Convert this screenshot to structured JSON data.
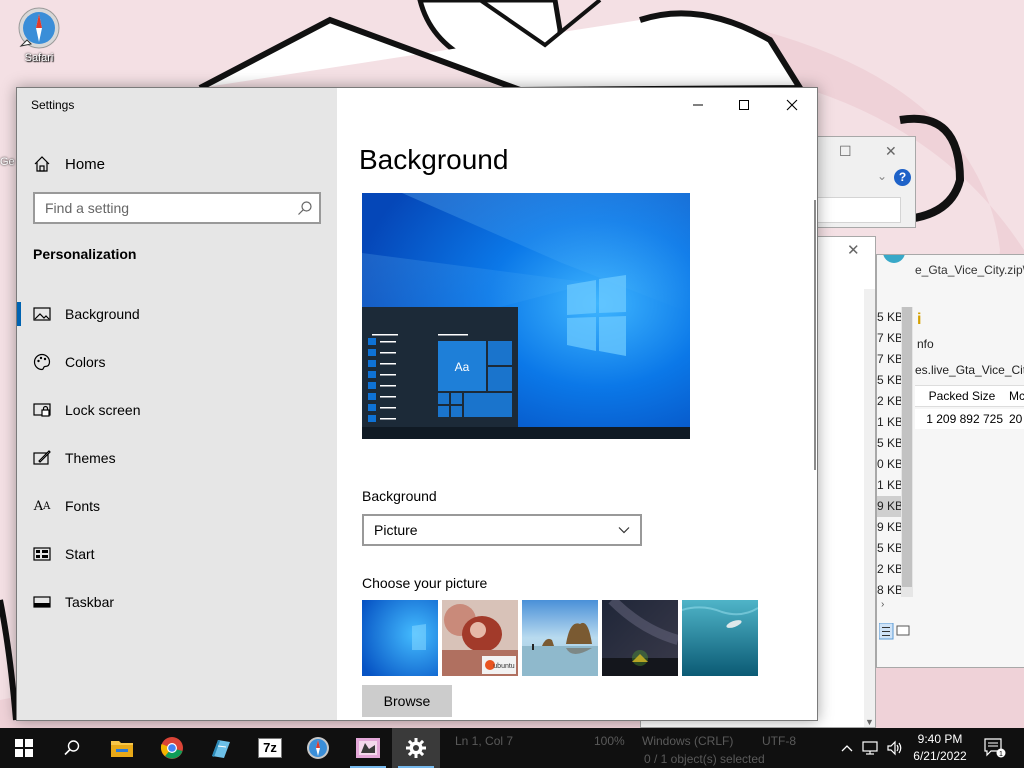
{
  "desktop": {
    "icons": [
      {
        "label": "Safari",
        "icon": "safari-icon"
      }
    ],
    "cut_label": "Ge"
  },
  "background_windows": {
    "archive_window": {
      "path": "e_Gta_Vice_City.zip\\",
      "info_label": "nfo",
      "file_name": "es.live_Gta_Vice_City.",
      "columns": [
        "Packed Size",
        "Mc"
      ],
      "row": {
        "packed_size": "1 209 892 725",
        "modified": "20"
      },
      "size_column": [
        "5 KB",
        "7 KB",
        "7 KB",
        "5 KB",
        "2 KB",
        "1 KB",
        "5 KB",
        "0 KB",
        "1 KB",
        "9 KB",
        "9 KB",
        "5 KB",
        "2 KB",
        "8 KB"
      ],
      "selected_size_index": 9
    }
  },
  "settings": {
    "app_title": "Settings",
    "window_controls": {
      "minimize": "minimize",
      "maximize": "maximize",
      "close": "close"
    },
    "nav": {
      "home_label": "Home",
      "search_placeholder": "Find a setting",
      "section_title": "Personalization",
      "items": [
        {
          "label": "Background",
          "icon": "picture-icon",
          "active": true
        },
        {
          "label": "Colors",
          "icon": "palette-icon",
          "active": false
        },
        {
          "label": "Lock screen",
          "icon": "lock-screen-icon",
          "active": false
        },
        {
          "label": "Themes",
          "icon": "brush-icon",
          "active": false
        },
        {
          "label": "Fonts",
          "icon": "font-icon",
          "active": false
        },
        {
          "label": "Start",
          "icon": "start-menu-icon",
          "active": false
        },
        {
          "label": "Taskbar",
          "icon": "taskbar-icon",
          "active": false
        }
      ]
    },
    "main": {
      "page_title": "Background",
      "preview_tile_text": "Aa",
      "background_label": "Background",
      "background_value": "Picture",
      "choose_label": "Choose your picture",
      "browse_label": "Browse",
      "thumbnails": [
        "windows-blue-wallpaper",
        "ubuntu-photo",
        "beach-rocks",
        "night-sky-tent",
        "underwater-diver"
      ],
      "thumbnail_caption": "ubuntu"
    }
  },
  "taskbar": {
    "apps": [
      "windows-start-icon",
      "search-icon",
      "file-explorer-icon",
      "chrome-icon",
      "notepad-icon",
      "7zip-icon",
      "safari-icon",
      "image-app-icon",
      "settings-gear-icon"
    ],
    "seven_zip_label": "7z",
    "ghost_status": {
      "line_col": "Ln 1, Col 7",
      "zoom": "100%",
      "eol": "Windows (CRLF)",
      "encoding": "UTF-8",
      "selection": "0 / 1 object(s) selected"
    },
    "clock": {
      "time": "9:40 PM",
      "date": "6/21/2022"
    },
    "notification_count": "1",
    "colors": {
      "accent": "#0063b1",
      "taskbar": "#101010"
    }
  }
}
